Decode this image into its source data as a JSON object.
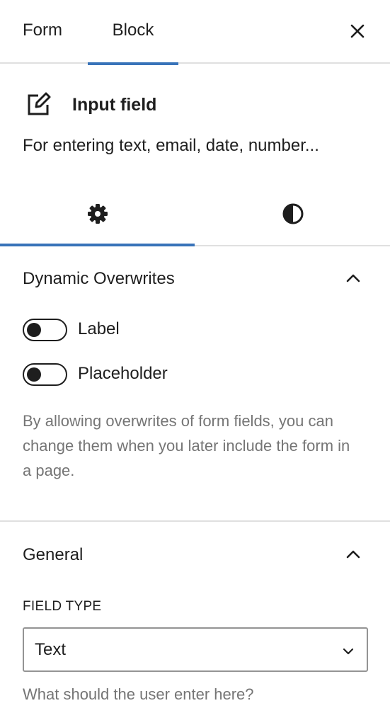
{
  "top_tabs": {
    "form_label": "Form",
    "block_label": "Block",
    "active": "Block"
  },
  "block_card": {
    "title": "Input field",
    "description": "For entering text, email, date, number...",
    "icon": "edit-icon"
  },
  "sub_tabs": {
    "settings_icon": "gear-icon",
    "styles_icon": "contrast-icon",
    "active": "settings"
  },
  "dynamic_overwrites": {
    "heading": "Dynamic Overwrites",
    "expanded": true,
    "toggles": [
      {
        "label": "Label",
        "checked": false
      },
      {
        "label": "Placeholder",
        "checked": false
      }
    ],
    "help": "By allowing overwrites of form fields, you can change them when you later include the form in a page."
  },
  "general": {
    "heading": "General",
    "expanded": true,
    "field_type_label": "FIELD TYPE",
    "field_type_value": "Text",
    "field_type_help": "What should the user enter here?"
  },
  "colors": {
    "accent": "#3873b9",
    "text": "#1e1e1e",
    "muted": "#757575",
    "border": "#e0e0e0"
  }
}
